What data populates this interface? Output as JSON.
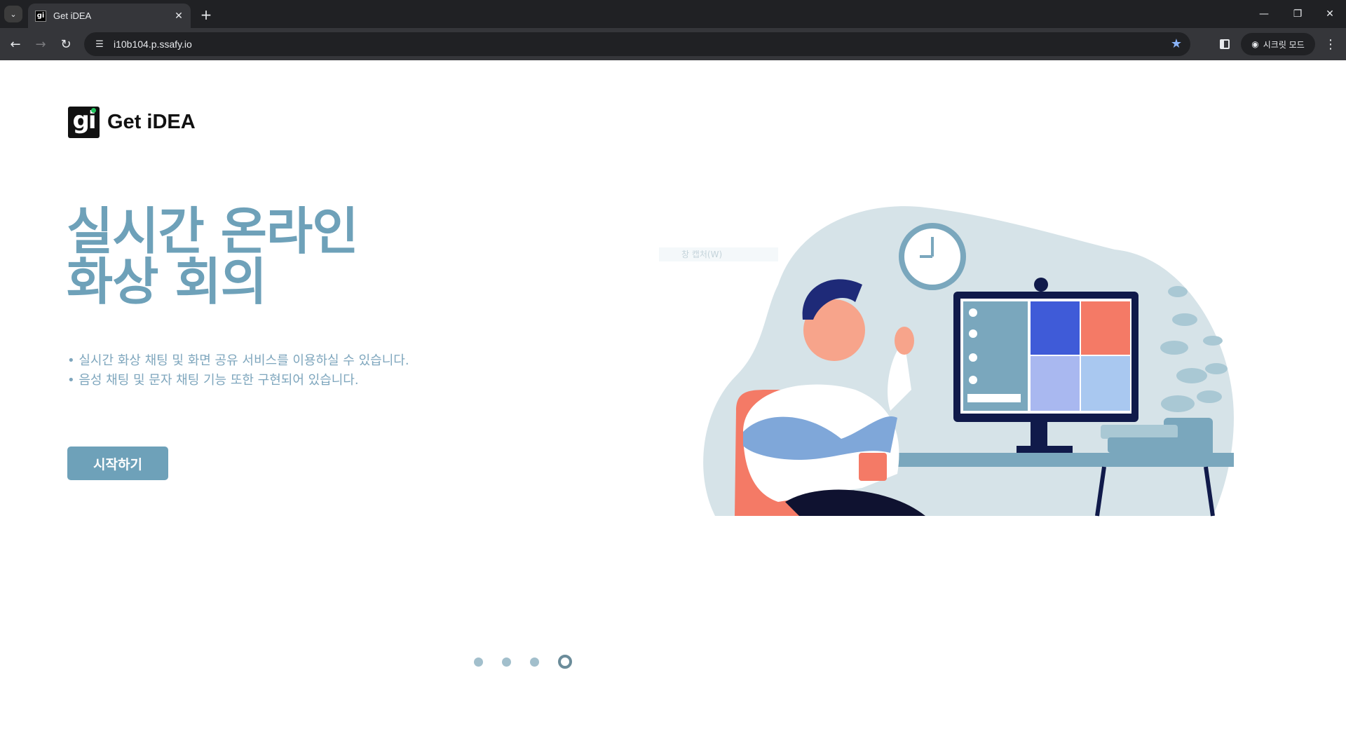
{
  "browser": {
    "tab_title": "Get iDEA",
    "favicon_text": "gi",
    "url": "i10b104.p.ssafy.io",
    "incognito_label": "시크릿 모드"
  },
  "page": {
    "logo_text": "Get iDEA",
    "logo_mark": "gi",
    "headline_line1": "실시간 온라인",
    "headline_line2": "화상 회의",
    "bullet1": "• 실시간 화상 채팅 및 화면 공유 서비스를 이용하실 수 있습니다.",
    "bullet2": "• 음성 채팅 및 문자 채팅 기능 또한 구현되어 있습니다.",
    "start_button": "시작하기",
    "ghost_text": "창 캡처(W)"
  },
  "pager": {
    "count": 4,
    "active_index": 3
  },
  "colors": {
    "accent": "#6ea1b9",
    "text_light": "#7ea6bd",
    "bg_blob": "#d6e3e8",
    "coral": "#f47a66",
    "navy": "#1e2a78"
  }
}
